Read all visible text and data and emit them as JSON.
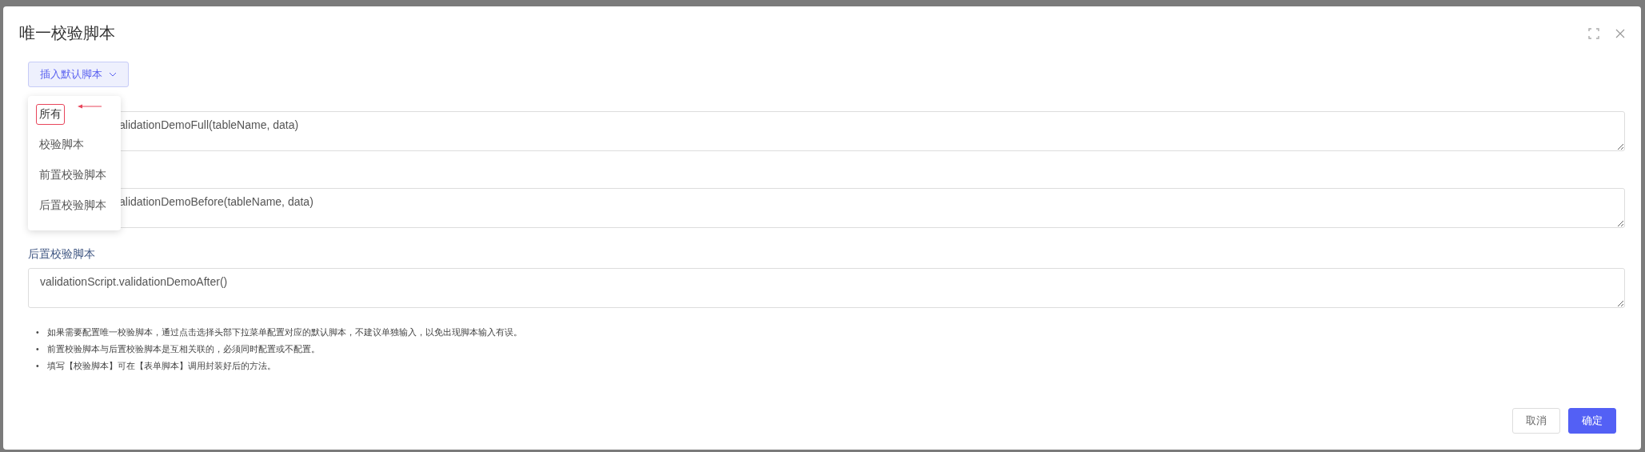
{
  "dialog": {
    "title": "唯一校验脚本"
  },
  "insert_button": {
    "label": "插入默认脚本"
  },
  "dropdown": {
    "items": [
      {
        "label": "所有",
        "selected": true
      },
      {
        "label": "校验脚本",
        "selected": false
      },
      {
        "label": "前置校验脚本",
        "selected": false
      },
      {
        "label": "后置校验脚本",
        "selected": false
      }
    ]
  },
  "fields": [
    {
      "value": "alidationDemoFull(tableName, data)"
    },
    {
      "value": "alidationDemoBefore(tableName, data)"
    },
    {
      "label": "后置校验脚本",
      "value": "validationScript.validationDemoAfter()"
    }
  ],
  "notes": [
    {
      "bullet": "•",
      "text": "如果需要配置唯一校验脚本，通过点击选择头部下拉菜单配置对应的默认脚本，不建议单独输入，以免出现脚本输入有误。"
    },
    {
      "bullet": "•",
      "text": "前置校验脚本与后置校验脚本是互相关联的，必须同时配置或不配置。"
    },
    {
      "bullet": "•",
      "text": "填写【校验脚本】可在【表单脚本】调用封装好后的方法。"
    }
  ],
  "buttons": [
    {
      "label": "取消",
      "kind": "secondary"
    },
    {
      "label": "确定",
      "kind": "primary"
    }
  ]
}
